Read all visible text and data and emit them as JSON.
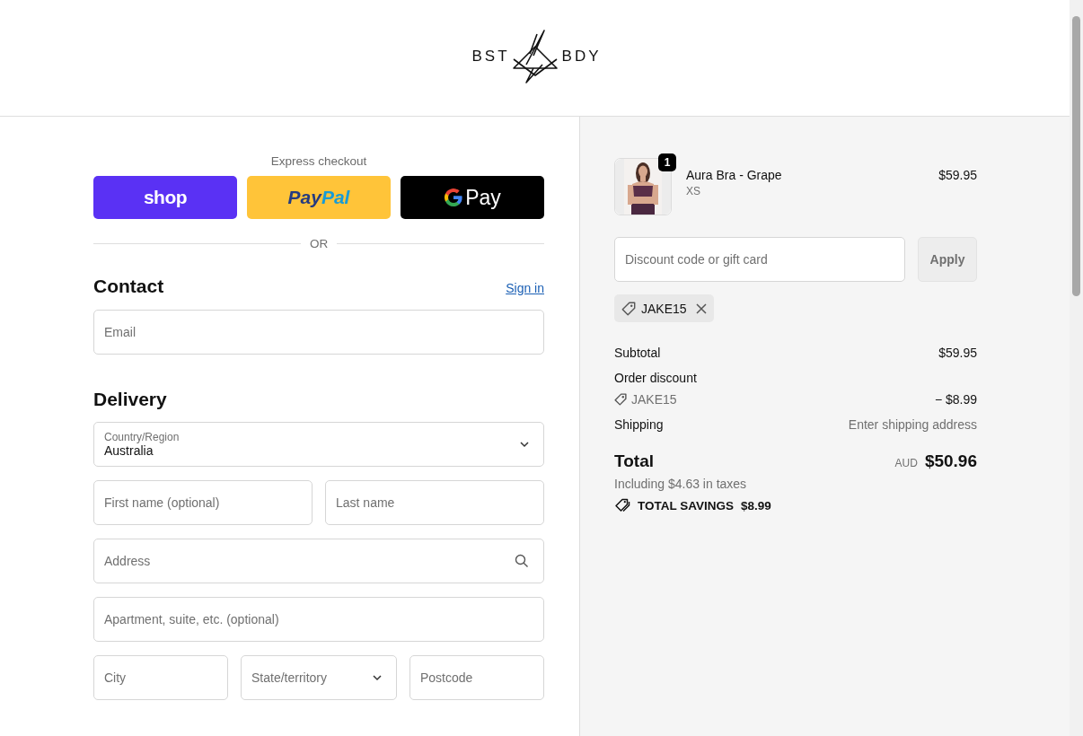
{
  "header": {
    "logo_left": "BST",
    "logo_right": "BDY"
  },
  "express": {
    "title": "Express checkout",
    "buttons": [
      {
        "kind": "shop",
        "label": "shop"
      },
      {
        "kind": "paypal",
        "label": "Pay",
        "label_2": "Pal"
      },
      {
        "kind": "gpay",
        "label": "Pay"
      }
    ],
    "divider": "OR"
  },
  "contact": {
    "heading": "Contact",
    "link": "Sign in",
    "fields": [
      {
        "kind": "text",
        "placeholder": "Email"
      }
    ]
  },
  "delivery": {
    "heading": "Delivery",
    "rows": [
      [
        {
          "kind": "select",
          "label": "Country/Region",
          "value": "Australia"
        }
      ],
      [
        {
          "kind": "text",
          "placeholder": "First name (optional)"
        },
        {
          "kind": "text",
          "placeholder": "Last name"
        }
      ],
      [
        {
          "kind": "search",
          "placeholder": "Address"
        }
      ],
      [
        {
          "kind": "text",
          "placeholder": "Apartment, suite, etc. (optional)"
        }
      ],
      [
        {
          "kind": "text",
          "placeholder": "City"
        },
        {
          "kind": "select",
          "placeholder": "State/territory"
        },
        {
          "kind": "text",
          "placeholder": "Postcode"
        }
      ]
    ]
  },
  "summary": {
    "items": [
      {
        "name": "Aura Bra - Grape",
        "variant": "XS",
        "price": "$59.95",
        "quantity": "1"
      }
    ],
    "discount": {
      "placeholder": "Discount code or gift card",
      "button": "Apply",
      "codes": [
        "JAKE15"
      ]
    },
    "lines": [
      {
        "kind": "row",
        "label": "Subtotal",
        "value": "$59.95"
      },
      {
        "kind": "heading",
        "label": "Order discount"
      },
      {
        "kind": "code",
        "label": "JAKE15",
        "value": "− $8.99"
      },
      {
        "kind": "muted",
        "label": "Shipping",
        "value": "Enter shipping address"
      }
    ],
    "total": {
      "label": "Total",
      "currency": "AUD",
      "value": "$50.96",
      "taxes": "Including $4.63 in taxes",
      "savings_label": "TOTAL SAVINGS",
      "savings_value": "$8.99"
    }
  }
}
